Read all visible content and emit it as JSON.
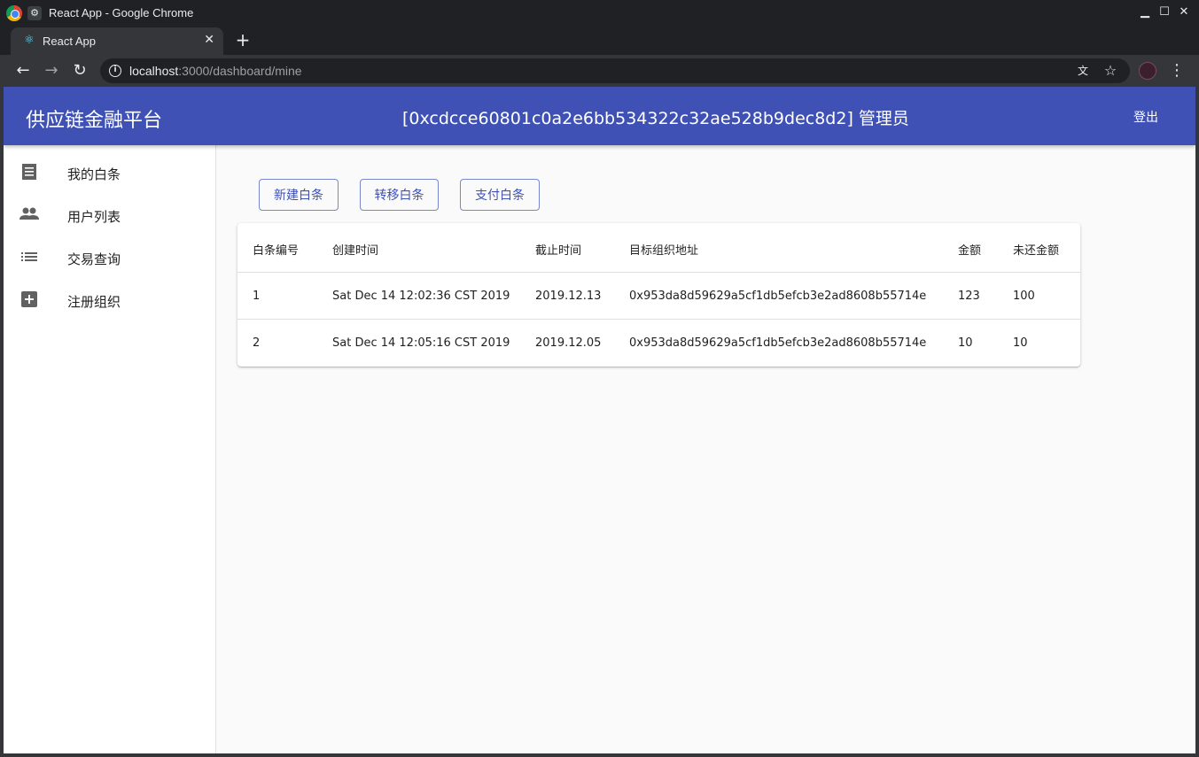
{
  "browser": {
    "window_title": "React App - Google Chrome",
    "tab_label": "React App",
    "url_host": "localhost",
    "url_rest": ":3000/dashboard/mine"
  },
  "appbar": {
    "brand": "供应链金融平台",
    "account": "[0xcdcce60801c0a2e6bb534322c32ae528b9dec8d2] 管理员",
    "logout": "登出"
  },
  "sidebar": {
    "items": [
      {
        "label": "我的白条",
        "icon": "receipt-icon"
      },
      {
        "label": "用户列表",
        "icon": "people-icon"
      },
      {
        "label": "交易查询",
        "icon": "list-icon"
      },
      {
        "label": "注册组织",
        "icon": "add-box-icon"
      }
    ]
  },
  "actions": {
    "new": "新建白条",
    "transfer": "转移白条",
    "pay": "支付白条"
  },
  "table": {
    "headers": [
      "白条编号",
      "创建时间",
      "截止时间",
      "目标组织地址",
      "金额",
      "未还金额"
    ],
    "rows": [
      [
        "1",
        "Sat Dec 14 12:02:36 CST 2019",
        "2019.12.13",
        "0x953da8d59629a5cf1db5efcb3e2ad8608b55714e",
        "123",
        "100"
      ],
      [
        "2",
        "Sat Dec 14 12:05:16 CST 2019",
        "2019.12.05",
        "0x953da8d59629a5cf1db5efcb3e2ad8608b55714e",
        "10",
        "10"
      ]
    ]
  },
  "colors": {
    "primary": "#3f51b5",
    "browser_chrome": "#35363a"
  }
}
